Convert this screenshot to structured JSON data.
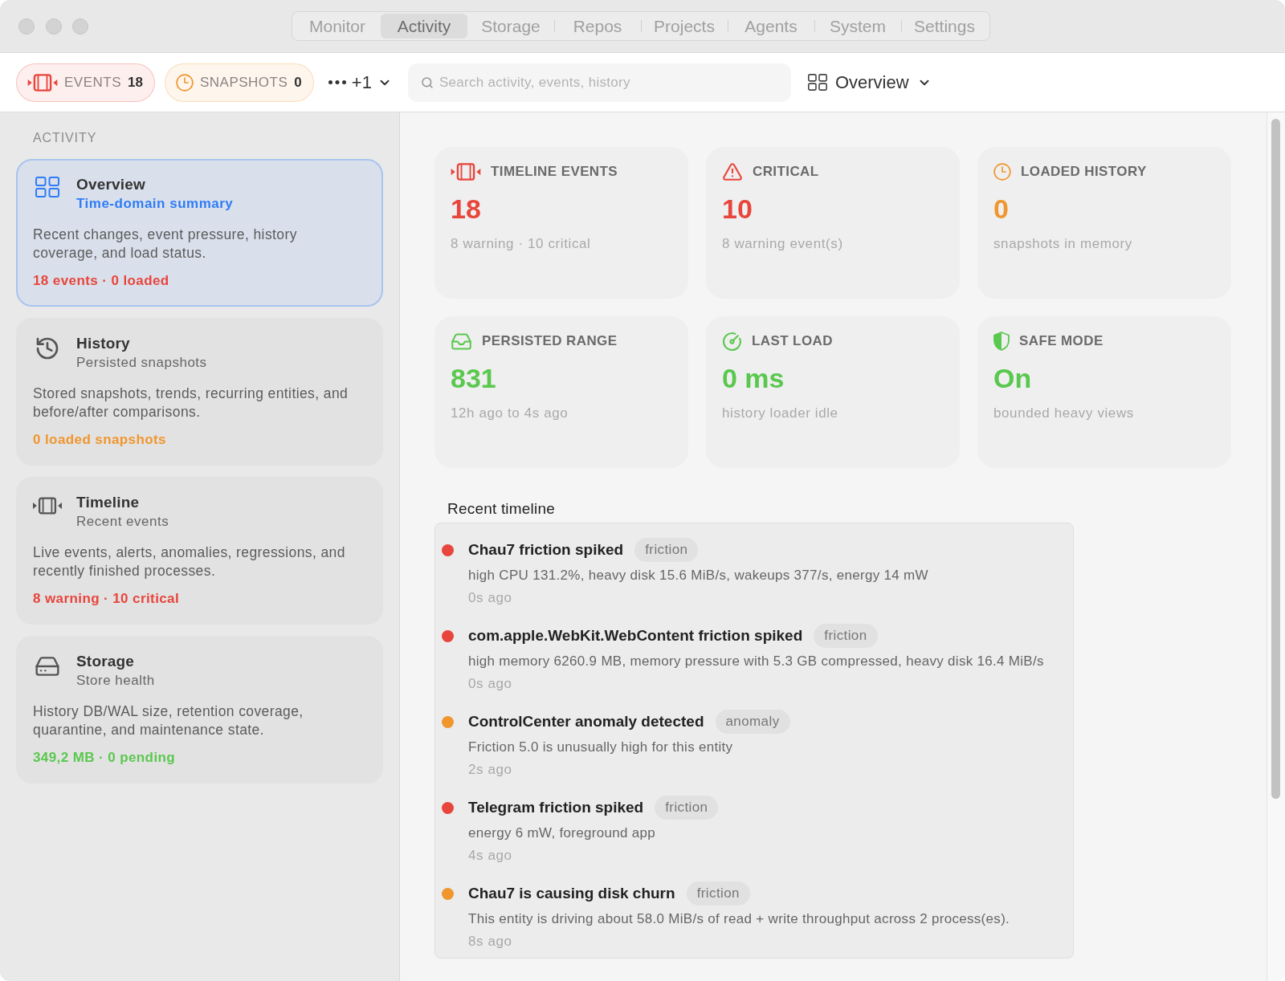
{
  "nav_tabs": [
    {
      "label": "Monitor",
      "selected": false
    },
    {
      "label": "Activity",
      "selected": true
    },
    {
      "label": "Storage",
      "selected": false
    },
    {
      "label": "Repos",
      "selected": false
    },
    {
      "label": "Projects",
      "selected": false
    },
    {
      "label": "Agents",
      "selected": false
    },
    {
      "label": "System",
      "selected": false
    },
    {
      "label": "Settings",
      "selected": false
    }
  ],
  "toolbar": {
    "chips": [
      {
        "kind": "events",
        "label": "EVENTS",
        "count": "18",
        "color": "#e8453c"
      },
      {
        "kind": "snapshots",
        "label": "SNAPSHOTS",
        "count": "0",
        "color": "#f0962e"
      }
    ],
    "more": {
      "label": "+1"
    },
    "search": {
      "placeholder": "Search activity, events, history"
    },
    "view_menu": {
      "label": "Overview"
    }
  },
  "sidebar": {
    "heading": "ACTIVITY",
    "items": [
      {
        "kind": "overview",
        "title": "Overview",
        "subtitle": "Time-domain summary",
        "description": "Recent changes, event pressure, history coverage, and load status.",
        "status": "18 events · 0 loaded",
        "color": "#e8453c",
        "selected": true
      },
      {
        "kind": "history",
        "title": "History",
        "subtitle": "Persisted snapshots",
        "description": "Stored snapshots, trends, recurring entities, and before/after comparisons.",
        "status": "0 loaded snapshots",
        "color": "#f0962e",
        "selected": false
      },
      {
        "kind": "timeline",
        "title": "Timeline",
        "subtitle": "Recent events",
        "description": "Live events, alerts, anomalies, regressions, and recently finished processes.",
        "status": "8 warning · 10 critical",
        "color": "#e8453c",
        "selected": false
      },
      {
        "kind": "storage",
        "title": "Storage",
        "subtitle": "Store health",
        "description": "History DB/WAL size, retention coverage, quarantine, and maintenance state.",
        "status": "349,2 MB · 0 pending",
        "color": "#5ac84f",
        "selected": false
      }
    ]
  },
  "stats": [
    {
      "kind": "events",
      "label": "TIMELINE EVENTS",
      "value": "18",
      "detail": "8 warning · 10 critical",
      "color": "#e8453c"
    },
    {
      "kind": "critical",
      "label": "CRITICAL",
      "value": "10",
      "detail": "8 warning event(s)",
      "color": "#e8453c"
    },
    {
      "kind": "history",
      "label": "LOADED HISTORY",
      "value": "0",
      "detail": "snapshots in memory",
      "color": "#f0962e"
    },
    {
      "kind": "range",
      "label": "PERSISTED RANGE",
      "value": "831",
      "detail": "12h ago to 4s ago",
      "color": "#5ac84f"
    },
    {
      "kind": "load",
      "label": "LAST LOAD",
      "value": "0 ms",
      "detail": "history loader idle",
      "color": "#5ac84f"
    },
    {
      "kind": "safe",
      "label": "SAFE MODE",
      "value": "On",
      "detail": "bounded heavy views",
      "color": "#5ac84f"
    }
  ],
  "timeline": {
    "title": "Recent timeline",
    "events": [
      {
        "title": "Chau7 friction spiked",
        "tag": "friction",
        "detail": "high CPU 131.2%, heavy disk 15.6 MiB/s, wakeups 377/s, energy 14 mW",
        "time": "0s ago",
        "color": "#e8453c"
      },
      {
        "title": "com.apple.WebKit.WebContent friction spiked",
        "tag": "friction",
        "detail": "high memory 6260.9 MB, memory pressure with 5.3 GB compressed, heavy disk 16.4 MiB/s",
        "time": "0s ago",
        "color": "#e8453c"
      },
      {
        "title": "ControlCenter anomaly detected",
        "tag": "anomaly",
        "detail": "Friction 5.0 is unusually high for this entity",
        "time": "2s ago",
        "color": "#f0962e"
      },
      {
        "title": "Telegram friction spiked",
        "tag": "friction",
        "detail": "energy 6 mW, foreground app",
        "time": "4s ago",
        "color": "#e8453c"
      },
      {
        "title": "Chau7 is causing disk churn",
        "tag": "friction",
        "detail": "This entity is driving about 58.0 MiB/s of read + write throughput across 2 process(es).",
        "time": "8s ago",
        "color": "#f0962e"
      }
    ]
  }
}
